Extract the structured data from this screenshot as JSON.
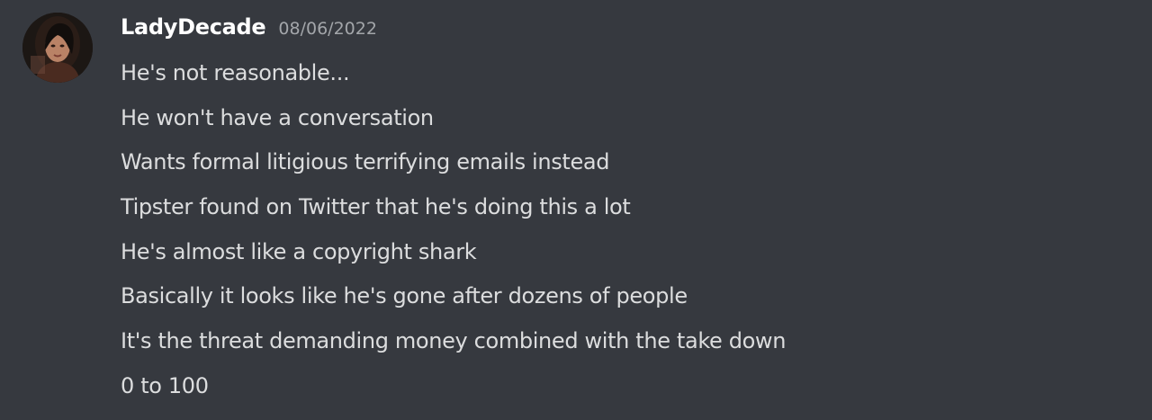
{
  "author": {
    "username": "LadyDecade",
    "timestamp": "08/06/2022",
    "avatar_icon": "user-avatar"
  },
  "messages": [
    "He's not reasonable...",
    "He won't have a conversation",
    "Wants formal litigious terrifying emails instead",
    "Tipster found on Twitter that he's doing this a lot",
    "He's almost like a copyright shark",
    "Basically it looks like he's gone after dozens of people",
    "It's the threat demanding money combined with the take down",
    "0 to 100"
  ],
  "colors": {
    "background": "#36393f",
    "username": "#ffffff",
    "timestamp": "#a3a6aa",
    "message_text": "#dcddde"
  }
}
